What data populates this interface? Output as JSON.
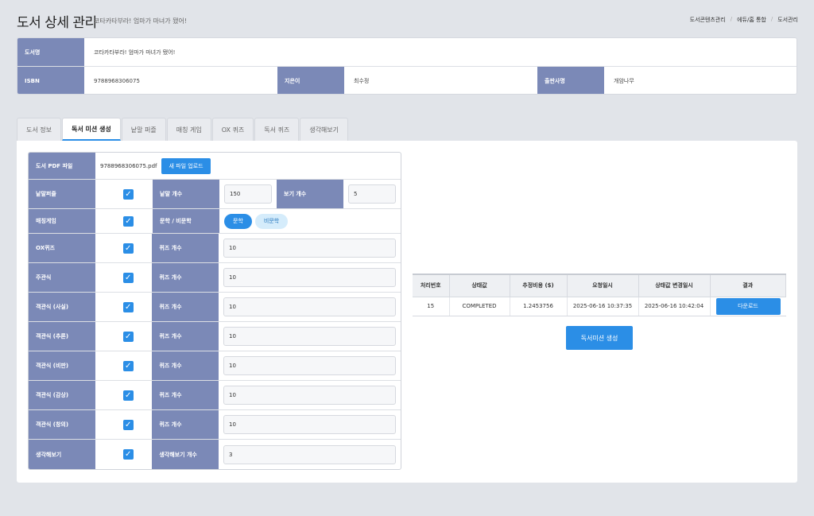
{
  "header": {
    "title": "도서 상세 관리",
    "subtitle": "코타카타부라! 엄마가 마녀가 됐어!",
    "breadcrumb": [
      "도서콘텐츠관리",
      "에듀/홈 통합",
      "도서관리"
    ]
  },
  "book_info": {
    "title_label": "도서명",
    "title_value": "코타카타부라! 엄마가 마녀가 됐어!",
    "isbn_label": "ISBN",
    "isbn_value": "9788968306075",
    "author_label": "지은이",
    "author_value": "최수정",
    "publisher_label": "출판사명",
    "publisher_value": "개암나무"
  },
  "tabs": [
    "도서 정보",
    "독서 미션 생성",
    "낱말 퍼즐",
    "매칭 게임",
    "OX 퀴즈",
    "독서 퀴즈",
    "생각해보기"
  ],
  "active_tab": 1,
  "form": {
    "pdf_label": "도서 PDF 파일",
    "pdf_filename": "9788968306075.pdf",
    "upload_button": "새 파일 업로드",
    "word_puzzle": {
      "label": "낱말퍼즐",
      "checked": true,
      "count_label": "낱말 개수",
      "count": "150",
      "option_label": "보기 개수",
      "option_count": "5"
    },
    "matching": {
      "label": "매칭게임",
      "checked": true,
      "type_label": "문학 / 비문학",
      "option_on": "문학",
      "option_off": "비문학"
    },
    "rows": [
      {
        "label": "OX퀴즈",
        "checked": true,
        "count_label": "퀴즈 개수",
        "count": "10"
      },
      {
        "label": "주관식",
        "checked": true,
        "count_label": "퀴즈 개수",
        "count": "10"
      },
      {
        "label": "객관식 (사실)",
        "checked": true,
        "count_label": "퀴즈 개수",
        "count": "10"
      },
      {
        "label": "객관식 (추론)",
        "checked": true,
        "count_label": "퀴즈 개수",
        "count": "10"
      },
      {
        "label": "객관식 (비판)",
        "checked": true,
        "count_label": "퀴즈 개수",
        "count": "10"
      },
      {
        "label": "객관식 (감상)",
        "checked": true,
        "count_label": "퀴즈 개수",
        "count": "10"
      },
      {
        "label": "객관식 (창의)",
        "checked": true,
        "count_label": "퀴즈 개수",
        "count": "10"
      },
      {
        "label": "생각해보기",
        "checked": true,
        "count_label": "생각해보기 개수",
        "count": "3"
      }
    ]
  },
  "results": {
    "columns": [
      "처리번호",
      "상태값",
      "추정비용 ($)",
      "요청일시",
      "상태값 변경일시",
      "결과"
    ],
    "rows": [
      {
        "id": "15",
        "status": "COMPLETED",
        "cost": "1.2453756",
        "requested": "2025-06-16 10:37:35",
        "changed": "2025-06-16 10:42:04",
        "action": "다운로드"
      }
    ]
  },
  "generate_button": "독서미션 생성"
}
